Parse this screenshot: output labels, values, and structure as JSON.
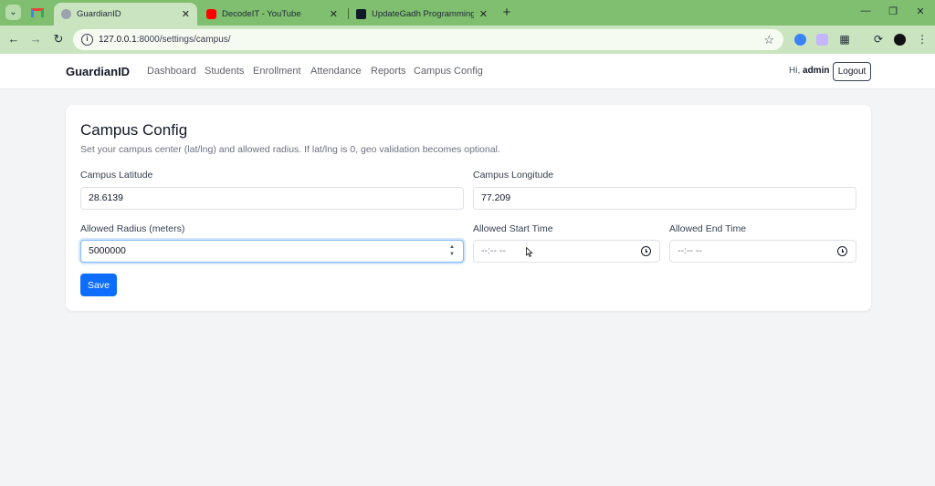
{
  "browser": {
    "tabs": [
      {
        "title": "GuardianID",
        "active": true
      },
      {
        "title": "DecodeIT - YouTube",
        "active": false
      },
      {
        "title": "UpdateGadh Programming - U",
        "active": false
      }
    ],
    "url_host": "127.0.0.1",
    "url_path": ":8000/settings/campus/"
  },
  "navbar": {
    "brand": "GuardianID",
    "links": [
      "Dashboard",
      "Students",
      "Enrollment",
      "Attendance",
      "Reports",
      "Campus Config"
    ],
    "greeting": "Hi,",
    "username": "admin",
    "logout_label": "Logout"
  },
  "campus": {
    "title": "Campus Config",
    "subtitle": "Set your campus center (lat/lng) and allowed radius. If lat/lng is 0, geo validation becomes optional.",
    "latitude_label": "Campus Latitude",
    "latitude_value": "28.6139",
    "longitude_label": "Campus Longitude",
    "longitude_value": "77.209",
    "radius_label": "Allowed Radius (meters)",
    "radius_value": "5000000",
    "start_label": "Allowed Start Time",
    "start_placeholder": "--:-- --",
    "end_label": "Allowed End Time",
    "end_placeholder": "--:-- --",
    "save_label": "Save"
  },
  "colors": {
    "tabstrip": "#7fbf6f",
    "toolbar": "#c9e4bf",
    "primary_button": "#0d6efd",
    "focus_ring": "#86b7fe"
  }
}
